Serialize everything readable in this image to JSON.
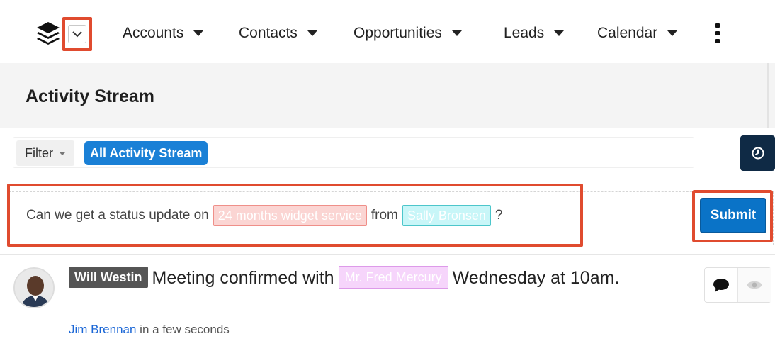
{
  "nav": {
    "items": [
      {
        "label": "Accounts"
      },
      {
        "label": "Contacts"
      },
      {
        "label": "Opportunities"
      },
      {
        "label": "Leads"
      },
      {
        "label": "Calendar"
      }
    ],
    "icons": {
      "logo": "stack-logo-icon",
      "toggle": "chevron-down-icon",
      "more": "kebab-menu-icon"
    }
  },
  "header": {
    "title": "Activity Stream"
  },
  "filter": {
    "button_label": "Filter",
    "active_filter": "All Activity Stream"
  },
  "compose": {
    "text_before": "Can we get a status update on",
    "mention_record": "24 months widget service",
    "text_middle": "from",
    "mention_user": "Sally Bronsen",
    "text_after": "?",
    "submit_label": "Submit"
  },
  "activity": {
    "author_tag": "Will Westin",
    "text_before": "Meeting confirmed with",
    "person_tag": "Mr. Fred Mercury",
    "text_after": "Wednesday at 10am.",
    "meta_user": "Jim Brennan",
    "meta_time": "in a few seconds"
  },
  "colors": {
    "accent": "#1a80d6",
    "highlight": "#e04b2f",
    "submit": "#0a73c7",
    "clock_button": "#0f2a45"
  }
}
